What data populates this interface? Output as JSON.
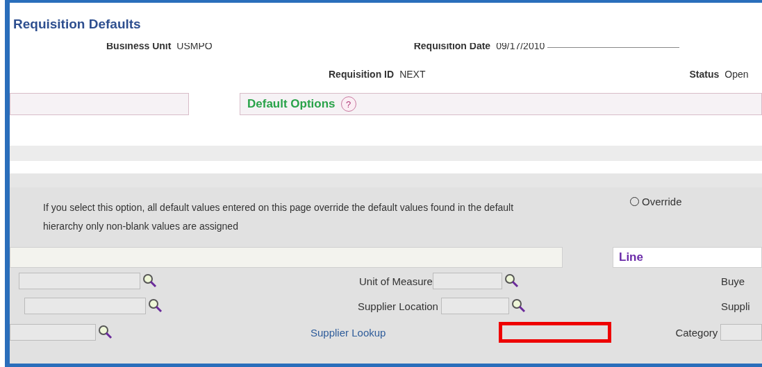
{
  "title": "Requisition Defaults",
  "header": {
    "business_unit_label": "Business Unit",
    "business_unit": "USMPO",
    "requisition_date_label": "Requisition Date",
    "requisition_date": "09/17/2010",
    "requisition_id_label": "Requisition ID",
    "requisition_id": "NEXT",
    "status_label": "Status",
    "status": "Open"
  },
  "default_options": {
    "title": "Default Options",
    "help": "?",
    "override": {
      "label": "Override",
      "selected": false
    },
    "description": "If you select this option, all default values entered on this page override the default values found in the default hierarchy only non-blank values are assigned"
  },
  "line_section": {
    "title": "Line"
  },
  "fields": {
    "unit_of_measure_label": "Unit of Measure",
    "buyer_label": "Buye",
    "supplier_location_label": "Supplier Location",
    "supplier_label": "Suppli",
    "supplier_lookup": "Supplier Lookup",
    "category_label": "Category"
  }
}
